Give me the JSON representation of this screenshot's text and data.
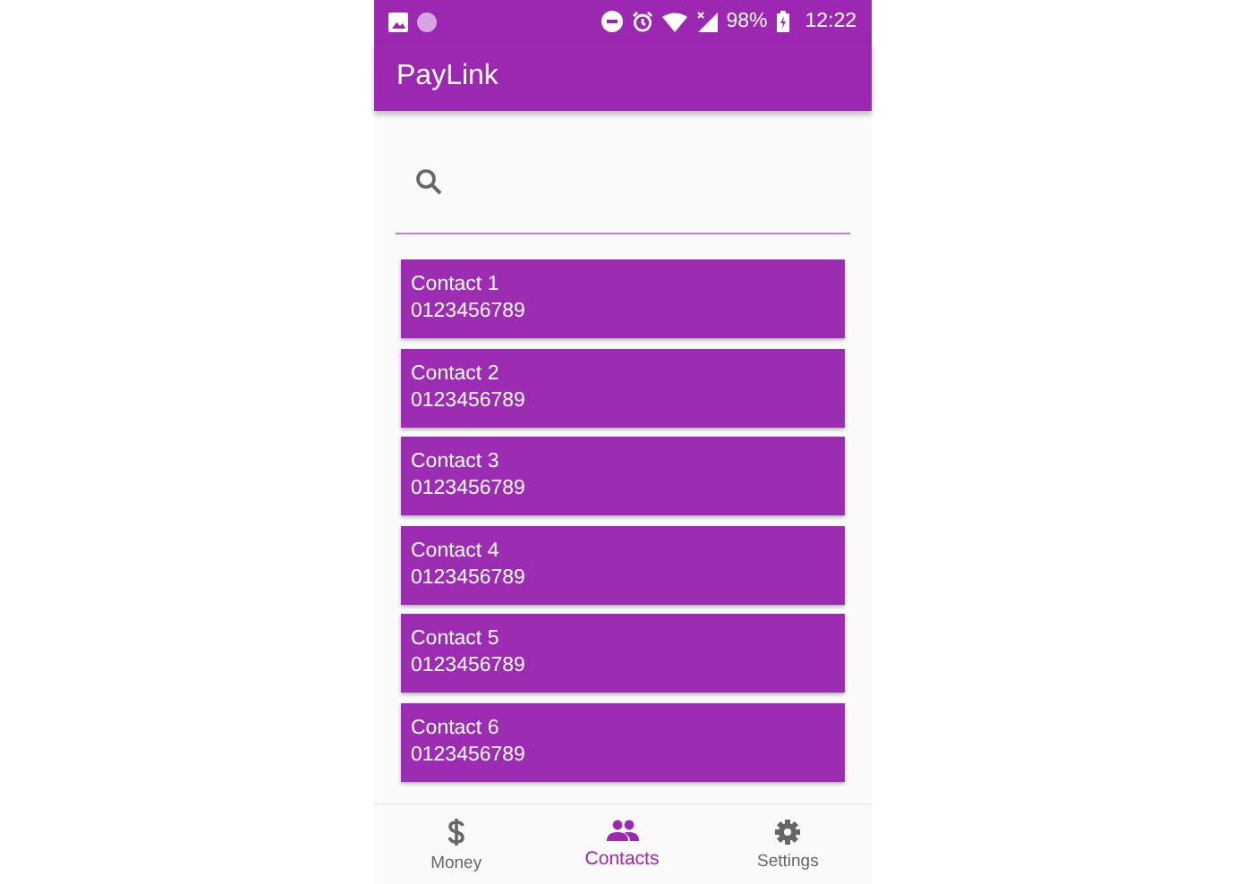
{
  "status_bar": {
    "battery": "98%",
    "time": "12:22"
  },
  "app_bar": {
    "title": "PayLink"
  },
  "contacts": [
    {
      "name": "Contact 1",
      "phone": "0123456789"
    },
    {
      "name": "Contact 2",
      "phone": "0123456789"
    },
    {
      "name": "Contact 3",
      "phone": "0123456789"
    },
    {
      "name": "Contact 4",
      "phone": "0123456789"
    },
    {
      "name": "Contact 5",
      "phone": "0123456789"
    },
    {
      "name": "Contact 6",
      "phone": "0123456789"
    }
  ],
  "bottom_nav": [
    {
      "kind": "money",
      "label": "Money",
      "selected": false
    },
    {
      "kind": "contacts",
      "label": "Contacts",
      "selected": true
    },
    {
      "kind": "settings",
      "label": "Settings",
      "selected": false
    }
  ]
}
